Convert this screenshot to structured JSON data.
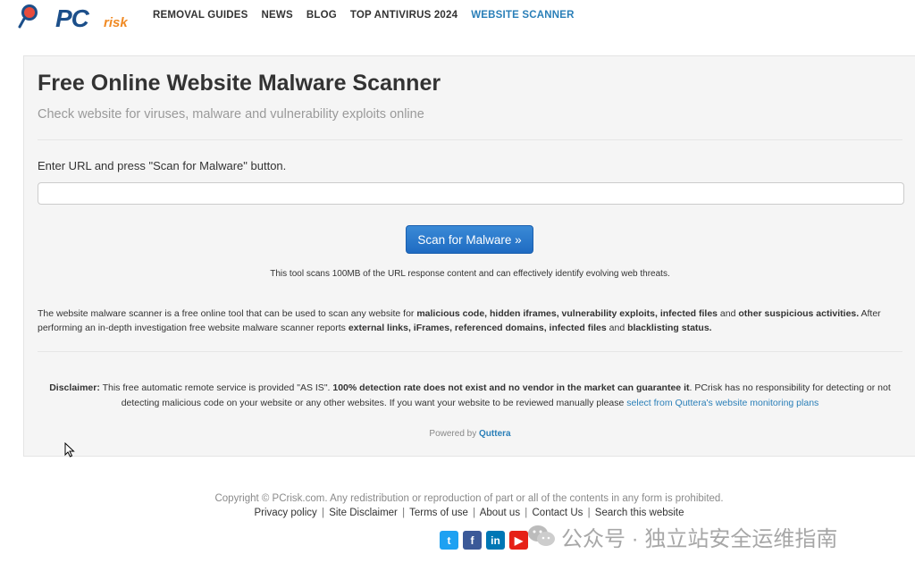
{
  "logo": {
    "main": "PC",
    "accent": "risk"
  },
  "nav": [
    {
      "label": "REMOVAL GUIDES",
      "active": false
    },
    {
      "label": "NEWS",
      "active": false
    },
    {
      "label": "BLOG",
      "active": false
    },
    {
      "label": "TOP ANTIVIRUS 2024",
      "active": false
    },
    {
      "label": "WEBSITE SCANNER",
      "active": true
    }
  ],
  "main": {
    "title": "Free Online Website Malware Scanner",
    "subtitle": "Check website for viruses, malware and vulnerability exploits online",
    "url_label": "Enter URL and press \"Scan for Malware\" button.",
    "url_value": "",
    "scan_button": "Scan for Malware »",
    "scan_note": "This tool scans 100MB of the URL response content and can effectively identify evolving web threats.",
    "desc": {
      "p1": "The website malware scanner is a free online tool that can be used to scan any website for ",
      "b1": "malicious code, hidden iframes, vulnerability exploits, infected files",
      "p2": " and ",
      "b2": "other suspicious activities.",
      "p3": " After performing an in-depth investigation free website malware scanner reports ",
      "b3": "external links, iFrames, referenced domains, infected files",
      "p4": " and ",
      "b4": "blacklisting status."
    },
    "disclaimer": {
      "label": "Disclaimer:",
      "p1": " This free automatic remote service is provided \"AS IS\". ",
      "b1": "100% detection rate does not exist and no vendor in the market can guarantee it",
      "p2": ". PCrisk has no responsibility for detecting or not detecting malicious code on your website or any other websites. If you want your website to be reviewed manually please ",
      "link": "select from Quttera's website monitoring plans"
    },
    "powered_prefix": "Powered by ",
    "powered_link": "Quttera"
  },
  "footer": {
    "copyright": "Copyright © PCrisk.com. Any redistribution or reproduction of part or all of the contents in any form is prohibited.",
    "links": [
      "Privacy policy",
      "Site Disclaimer",
      "Terms of use",
      "About us",
      "Contact Us",
      "Search this website"
    ],
    "social": [
      {
        "name": "twitter-icon",
        "glyph": "t"
      },
      {
        "name": "facebook-icon",
        "glyph": "f"
      },
      {
        "name": "linkedin-icon",
        "glyph": "in"
      },
      {
        "name": "youtube-icon",
        "glyph": "▶"
      }
    ]
  },
  "watermark": "公众号 · 独立站安全运维指南",
  "colors": {
    "accent": "#2a7fb8",
    "button": "#1f6bc2",
    "logo_blue": "#1c4f8a",
    "logo_orange": "#f08a24"
  }
}
